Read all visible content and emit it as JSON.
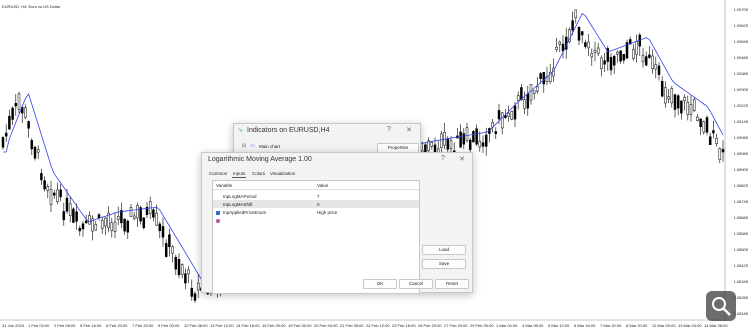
{
  "chart": {
    "title": "EURUSD, H4: Euro vs US Dollar",
    "price_ticks": [
      "1.09705",
      "1.09625",
      "1.09545",
      "1.09465",
      "1.09385",
      "1.09305",
      "1.09225",
      "1.09145",
      "1.09065",
      "1.08985",
      "1.08905",
      "1.08825",
      "1.08745",
      "1.08665",
      "1.08585",
      "1.08505",
      "1.08425",
      "1.08345",
      "1.08265",
      "1.08185"
    ],
    "time_ticks": [
      "31 Jan 2024",
      "1 Feb 04:00",
      "2 Feb 08:00",
      "5 Feb 16:00",
      "6 Feb 20:00",
      "7 Feb 20:00",
      "9 Feb 00:00",
      "12 Feb 08:00",
      "13 Feb 12:00",
      "14 Feb 16:00",
      "15 Feb 20:00",
      "19 Feb 00:00",
      "20 Feb 04:00",
      "21 Feb 08:00",
      "22 Feb 12:00",
      "23 Feb 16:00",
      "26 Feb 20:00",
      "27 Feb 20:00",
      "29 Feb 00:00",
      "1 Mar 04:00",
      "4 Mar 08:00",
      "5 Mar 12:00",
      "6 Mar 16:00",
      "7 Mar 20:00",
      "8 Mar 20:00",
      "12 Mar 00:00",
      "13 Mar 04:00",
      "14 Mar 08:00"
    ],
    "ma_color": "#3344ee",
    "candle_color": "#000000"
  },
  "indicators_dialog": {
    "title": "Indicators on EURUSD,H4",
    "tree_item": "Main chart",
    "properties_label": "Properties",
    "help_label": "?",
    "close_label": "✕"
  },
  "lma_dialog": {
    "title": "Logarithmic Moving Average 1.00",
    "help_label": "?",
    "close_label": "✕",
    "tabs": [
      "Common",
      "Inputs",
      "Colors",
      "Visualization"
    ],
    "active_tab": "Inputs",
    "table": {
      "col_variable": "Variable",
      "col_value": "Value",
      "rows": [
        {
          "variable": "InpLogMAPeriod",
          "value": "7",
          "icon": "int-icon"
        },
        {
          "variable": "InpLogMAShift",
          "value": "0",
          "icon": "int-icon"
        },
        {
          "variable": "InpAppliedPriceEnum",
          "value": "High price",
          "icon": "enum-icon"
        }
      ]
    },
    "load_label": "Load",
    "save_label": "Save",
    "ok_label": "OK",
    "cancel_label": "Cancel",
    "reset_label": "Reset"
  }
}
